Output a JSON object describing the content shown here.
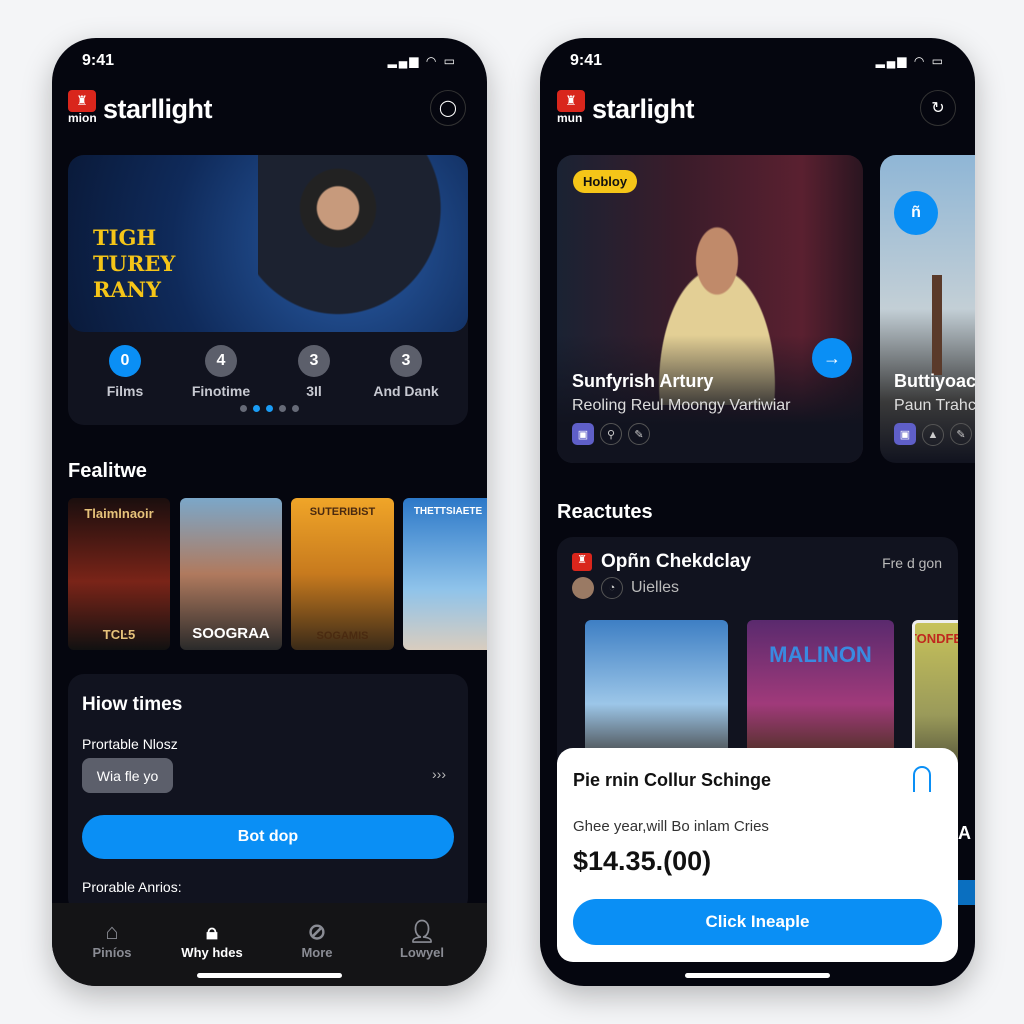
{
  "left": {
    "status_time": "9:41",
    "logo_text": "mion",
    "brand": "starllight",
    "hero": {
      "title": "TIGH TUREY RANY"
    },
    "stats": [
      {
        "value": "0",
        "label": "Films",
        "active": true
      },
      {
        "value": "4",
        "label": "Finotime",
        "active": false
      },
      {
        "value": "3",
        "label": "3Il",
        "active": false
      },
      {
        "value": "3",
        "label": "And Dank",
        "active": false
      }
    ],
    "carousel": {
      "pages": 5,
      "active": [
        1,
        2
      ]
    },
    "featured_title": "Fealitwe",
    "posters": [
      {
        "title": "Tlaimlnaoir",
        "sub": "TCĿ5"
      },
      {
        "title": "SOOGRAA",
        "sub": ""
      },
      {
        "title": "SUTERIBIST",
        "sub": "SOGAMIS"
      },
      {
        "title": "THETTSIAETE",
        "sub": ""
      }
    ],
    "showtimes": {
      "title": "Hiow times",
      "label1": "Prortable Nlosz",
      "chip": "Wia fle yo",
      "more": "›››",
      "button": "Bot dop",
      "label2": "Prorable Anrios:"
    },
    "tabs": [
      {
        "label": "Piníos",
        "icon": "home-icon",
        "active": false
      },
      {
        "label": "Why hdes",
        "icon": "lock-icon",
        "active": true
      },
      {
        "label": "More",
        "icon": "compass-icon",
        "active": false
      },
      {
        "label": "Lowyel",
        "icon": "profile-icon",
        "active": false
      }
    ]
  },
  "right": {
    "status_time": "9:41",
    "logo_text": "mun",
    "brand": "starlight",
    "card1": {
      "badge": "Hobloy",
      "title": "Sunfyrish Artury",
      "subtitle": "Reoling Reul Moongy Vartiwiar"
    },
    "card2": {
      "title": "Buttiyoac",
      "subtitle": "Paun Trahc"
    },
    "section_title": "Reactutes",
    "list": {
      "title": "Opñn Chekdclay",
      "side": "Fre d gon",
      "sub": "Uielles",
      "posters": [
        {
          "title": ""
        },
        {
          "title": "MALINON"
        },
        {
          "title": "TONDFEIN"
        }
      ]
    },
    "peek_text": "A",
    "popup": {
      "title": "Pie rnin Collur Schinge",
      "body": "Ghee year,will Bo inlam Cries",
      "price": "$14.35.(00)",
      "button": "Click Ineaple"
    }
  },
  "colors": {
    "accent": "#0a8ff5",
    "badge": "#f5c518",
    "logo": "#d9261c",
    "bg": "#05060f"
  }
}
